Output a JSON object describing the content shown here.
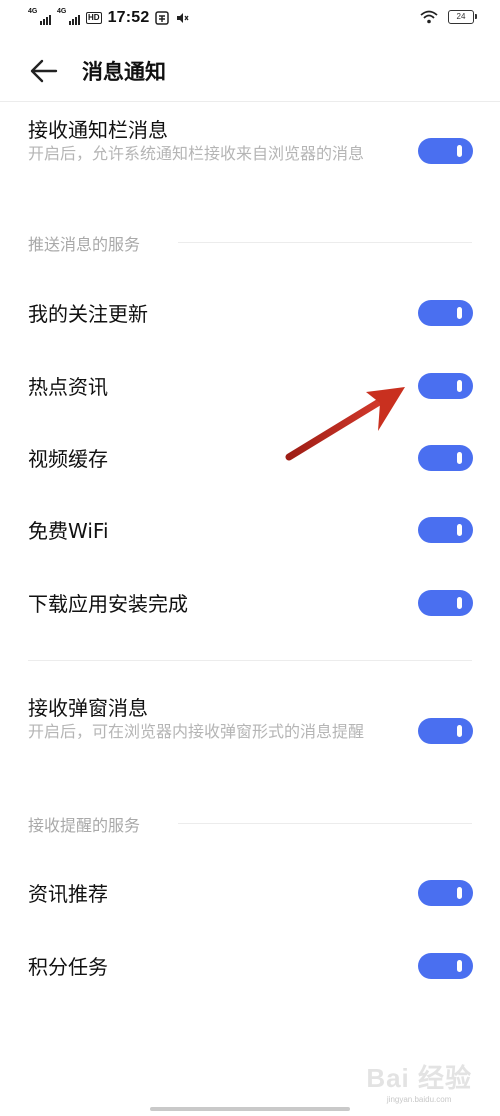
{
  "status_bar": {
    "signal1": "4G",
    "signal2": "4G",
    "hd": "HD",
    "time": "17:52",
    "battery": "24"
  },
  "header": {
    "title": "消息通知"
  },
  "notification_bar": {
    "title": "接收通知栏消息",
    "subtitle": "开启后，允许系统通知栏接收来自浏览器的消息",
    "enabled": true
  },
  "push_section": {
    "label": "推送消息的服务",
    "items": [
      {
        "label": "我的关注更新",
        "enabled": true
      },
      {
        "label": "热点资讯",
        "enabled": true
      },
      {
        "label": "视频缓存",
        "enabled": true
      },
      {
        "label": "免费WiFi",
        "enabled": true
      },
      {
        "label": "下载应用安装完成",
        "enabled": true
      }
    ]
  },
  "popup": {
    "title": "接收弹窗消息",
    "subtitle": "开启后，可在浏览器内接收弹窗形式的消息提醒",
    "enabled": true
  },
  "reminder_section": {
    "label": "接收提醒的服务",
    "items": [
      {
        "label": "资讯推荐",
        "enabled": true
      },
      {
        "label": "积分任务",
        "enabled": true
      }
    ]
  },
  "watermark": {
    "logo": "Bai 经验",
    "sub": "jingyan.baidu.com"
  },
  "colors": {
    "toggle_on": "#4a6ff0",
    "annotation_arrow": "#c0281e"
  }
}
